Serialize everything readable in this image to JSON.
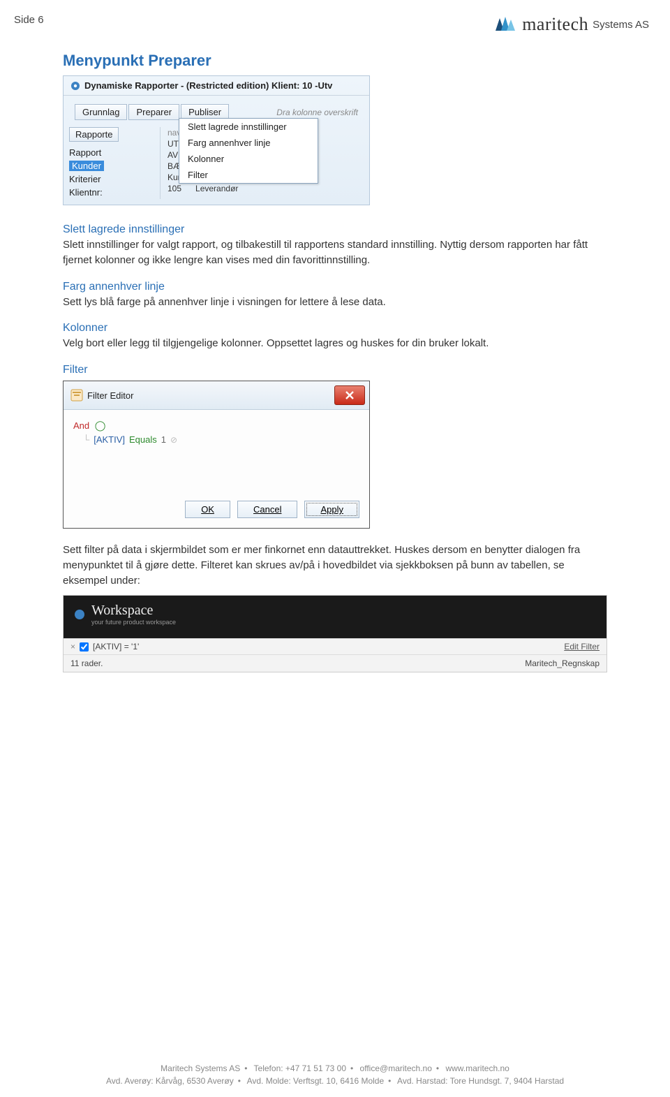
{
  "header": {
    "side": "Side 6",
    "brand_name": "maritech",
    "brand_suffix": "Systems AS"
  },
  "headings": {
    "main": "Menypunkt Preparer",
    "sub1": "Slett lagrede innstillinger",
    "sub2": "Farg annenhver linje",
    "sub3": "Kolonner",
    "sub4": "Filter"
  },
  "paragraphs": {
    "p1": "Slett innstillinger for valgt rapport, og tilbakestill til rapportens standard innstilling. Nyttig dersom rapporten har fått fjernet kolonner og ikke lengre kan vises med din favorittinnstilling.",
    "p2": "Sett lys blå farge på annenhver linje i visningen for lettere å lese data.",
    "p3": "Velg bort eller legg til tilgjengelige kolonner. Oppsettet lagres og huskes for din bruker lokalt.",
    "p4": "Sett filter på data i skjermbildet som er mer finkornet enn datauttrekket. Huskes dersom en benytter dialogen fra menypunktet til å gjøre dette. Filteret kan skrues av/på i hovedbildet via sjekkboksen på bunn av tabellen, se eksempel under:"
  },
  "screenshot1": {
    "title": "Dynamiske Rapporter - (Restricted edition) Klient: 10 -Utv",
    "tabs": [
      "Grunnlag",
      "Preparer",
      "Publiser"
    ],
    "drag_hint": "Dra kolonne overskrift",
    "left_button": "Rapporte",
    "left_rows": [
      "Rapport",
      "Kunder",
      "Kriterier",
      "Klientnr:"
    ],
    "menu_items": [
      "Slett lagrede innstillinger",
      "Farg annenhver linje",
      "Kolonner",
      "Filter"
    ],
    "right_header": "navn",
    "right_rows": [
      "UTEN AVDE",
      "AVDELINGS",
      "BÆRERBAS",
      "Kunder",
      "Leverandør"
    ],
    "right_num": "105"
  },
  "filter_editor": {
    "title": "Filter Editor",
    "root_op": "And",
    "field": "[AKTIV]",
    "op": "Equals",
    "val": "1",
    "buttons": {
      "ok": "OK",
      "cancel": "Cancel",
      "apply": "Apply"
    }
  },
  "footer_bar": {
    "ws_title": "Workspace",
    "ws_sub": "your future product workspace",
    "filter_expr": "[AKTIV] = '1'",
    "edit_filter": "Edit Filter",
    "row_count": "11 rader.",
    "db": "Maritech_Regnskap"
  },
  "page_footer": {
    "line1_a": "Maritech Systems AS",
    "line1_b": "Telefon: +47 71 51 73 00",
    "line1_c": "office@maritech.no",
    "line1_d": "www.maritech.no",
    "line2_a": "Avd. Averøy: Kårvåg, 6530 Averøy",
    "line2_b": "Avd. Molde: Verftsgt. 10, 6416 Molde",
    "line2_c": "Avd. Harstad: Tore Hundsgt. 7, 9404 Harstad"
  }
}
